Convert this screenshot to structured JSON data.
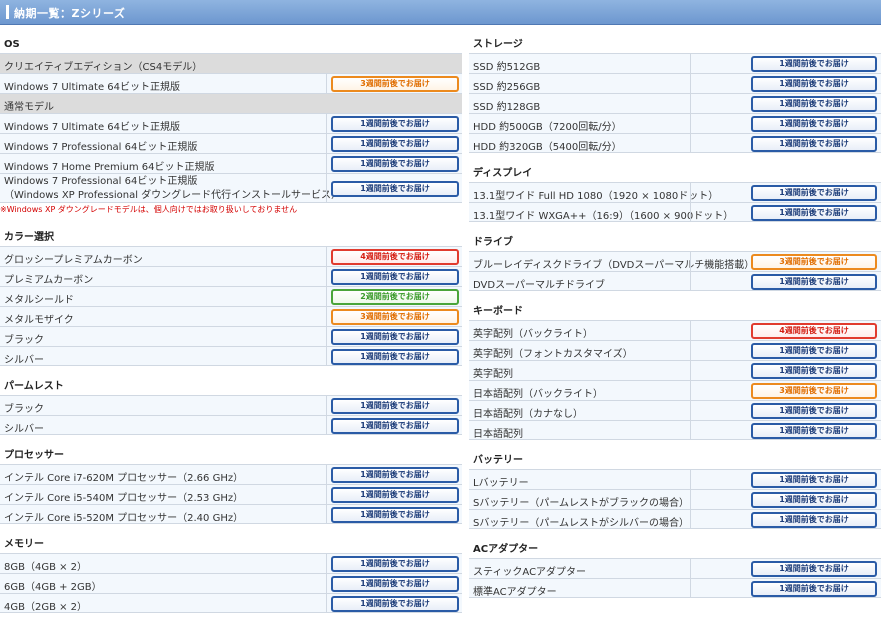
{
  "header": {
    "title": "納期一覧：Zシリーズ"
  },
  "left": [
    {
      "title": "OS",
      "rows": [
        {
          "label": "クリエイティブエディション（CS4モデル）",
          "type": "sub"
        },
        {
          "label": "Windows 7 Ultimate 64ビット正規版",
          "badge": "3週間前後でお届け",
          "color": "orange"
        },
        {
          "label": "通常モデル",
          "type": "sub"
        },
        {
          "label": "Windows 7 Ultimate 64ビット正規版",
          "badge": "1週間前後でお届け",
          "color": "blue"
        },
        {
          "label": "Windows 7 Professional 64ビット正規版",
          "badge": "1週間前後でお届け",
          "color": "blue"
        },
        {
          "label": "Windows 7 Home Premium 64ビット正規版",
          "badge": "1週間前後でお届け",
          "color": "blue"
        },
        {
          "label": "Windows 7 Professional 64ビット正規版",
          "label2": "（Windows XP Professional ダウングレード代行インストールサービス）",
          "badge": "1週間前後でお届け",
          "color": "blue",
          "tall": true
        }
      ],
      "note": "※Windows XP ダウングレードモデルは、個人向けではお取り扱いしておりません"
    },
    {
      "title": "カラー選択",
      "rows": [
        {
          "label": "グロッシープレミアムカーボン",
          "badge": "4週間前後でお届け",
          "color": "red"
        },
        {
          "label": "プレミアムカーボン",
          "badge": "1週間前後でお届け",
          "color": "blue"
        },
        {
          "label": "メタルシールド",
          "badge": "2週間前後でお届け",
          "color": "green"
        },
        {
          "label": "メタルモザイク",
          "badge": "3週間前後でお届け",
          "color": "orange"
        },
        {
          "label": "ブラック",
          "badge": "1週間前後でお届け",
          "color": "blue"
        },
        {
          "label": "シルバー",
          "badge": "1週間前後でお届け",
          "color": "blue"
        }
      ]
    },
    {
      "title": "パームレスト",
      "rows": [
        {
          "label": "ブラック",
          "badge": "1週間前後でお届け",
          "color": "blue"
        },
        {
          "label": "シルバー",
          "badge": "1週間前後でお届け",
          "color": "blue"
        }
      ]
    },
    {
      "title": "プロセッサー",
      "rows": [
        {
          "label": "インテル Core i7-620M プロセッサー（2.66 GHz）",
          "badge": "1週間前後でお届け",
          "color": "blue"
        },
        {
          "label": "インテル Core i5-540M プロセッサー（2.53 GHz）",
          "badge": "1週間前後でお届け",
          "color": "blue"
        },
        {
          "label": "インテル Core i5-520M プロセッサー（2.40 GHz）",
          "badge": "1週間前後でお届け",
          "color": "blue"
        }
      ]
    },
    {
      "title": "メモリー",
      "rows": [
        {
          "label": "8GB（4GB × 2）",
          "badge": "1週間前後でお届け",
          "color": "blue"
        },
        {
          "label": "6GB（4GB + 2GB）",
          "badge": "1週間前後でお届け",
          "color": "blue"
        },
        {
          "label": "4GB（2GB × 2）",
          "badge": "1週間前後でお届け",
          "color": "blue"
        }
      ]
    }
  ],
  "right": [
    {
      "title": "ストレージ",
      "rows": [
        {
          "label": "SSD 約512GB",
          "badge": "1週間前後でお届け",
          "color": "blue"
        },
        {
          "label": "SSD 約256GB",
          "badge": "1週間前後でお届け",
          "color": "blue"
        },
        {
          "label": "SSD 約128GB",
          "badge": "1週間前後でお届け",
          "color": "blue"
        },
        {
          "label": "HDD 約500GB（7200回転/分）",
          "badge": "1週間前後でお届け",
          "color": "blue"
        },
        {
          "label": "HDD 約320GB（5400回転/分）",
          "badge": "1週間前後でお届け",
          "color": "blue"
        }
      ]
    },
    {
      "title": "ディスプレイ",
      "rows": [
        {
          "label": "13.1型ワイド Full HD 1080（1920 × 1080ドット）",
          "badge": "1週間前後でお届け",
          "color": "blue"
        },
        {
          "label": "13.1型ワイド WXGA++（16:9）（1600 × 900ドット）",
          "badge": "1週間前後でお届け",
          "color": "blue"
        }
      ]
    },
    {
      "title": "ドライブ",
      "rows": [
        {
          "label": "ブルーレイディスクドライブ（DVDスーパーマルチ機能搭載）",
          "badge": "3週間前後でお届け",
          "color": "orange"
        },
        {
          "label": "DVDスーパーマルチドライブ",
          "badge": "1週間前後でお届け",
          "color": "blue"
        }
      ]
    },
    {
      "title": "キーボード",
      "rows": [
        {
          "label": "英字配列（バックライト）",
          "badge": "4週間前後でお届け",
          "color": "red"
        },
        {
          "label": "英字配列（フォントカスタマイズ）",
          "badge": "1週間前後でお届け",
          "color": "blue"
        },
        {
          "label": "英字配列",
          "badge": "1週間前後でお届け",
          "color": "blue"
        },
        {
          "label": "日本語配列（バックライト）",
          "badge": "3週間前後でお届け",
          "color": "orange"
        },
        {
          "label": "日本語配列（カナなし）",
          "badge": "1週間前後でお届け",
          "color": "blue"
        },
        {
          "label": "日本語配列",
          "badge": "1週間前後でお届け",
          "color": "blue"
        }
      ]
    },
    {
      "title": "バッテリー",
      "rows": [
        {
          "label": "Lバッテリー",
          "badge": "1週間前後でお届け",
          "color": "blue"
        },
        {
          "label": "Sバッテリー（パームレストがブラックの場合）",
          "badge": "1週間前後でお届け",
          "color": "blue"
        },
        {
          "label": "Sバッテリー（パームレストがシルバーの場合）",
          "badge": "1週間前後でお届け",
          "color": "blue"
        }
      ]
    },
    {
      "title": "ACアダプター",
      "rows": [
        {
          "label": "スティックACアダプター",
          "badge": "1週間前後でお届け",
          "color": "blue"
        },
        {
          "label": "標準ACアダプター",
          "badge": "1週間前後でお届け",
          "color": "blue"
        }
      ]
    }
  ]
}
